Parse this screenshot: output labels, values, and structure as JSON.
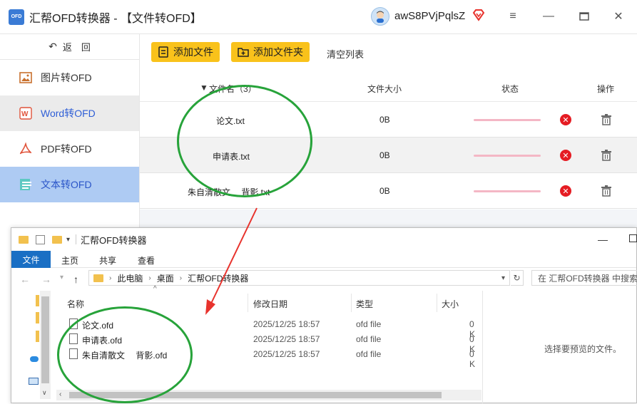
{
  "titlebar": {
    "logo_text": "OFD",
    "title": "汇帮OFD转换器 - 【文件转OFD】",
    "username": "awS8PVjPqlsZ"
  },
  "sidebar": {
    "back_label": "返　回",
    "items": [
      {
        "label": "图片转OFD",
        "icon": "image-icon"
      },
      {
        "label": "Word转OFD",
        "icon": "word-icon"
      },
      {
        "label": "PDF转OFD",
        "icon": "pdf-icon"
      },
      {
        "label": "文本转OFD",
        "icon": "text-doc-icon"
      }
    ]
  },
  "toolbar": {
    "add_file": "添加文件",
    "add_folder": "添加文件夹",
    "clear_list": "清空列表"
  },
  "table": {
    "headers": {
      "name": "文件名（3）",
      "size": "文件大小",
      "status": "状态",
      "action": "操作"
    },
    "rows": [
      {
        "name": "论文.txt",
        "size": "0B"
      },
      {
        "name": "申请表.txt",
        "size": "0B"
      },
      {
        "name": "朱自清散文　 背影.txt",
        "size": "0B"
      }
    ]
  },
  "explorer": {
    "title": "汇帮OFD转换器",
    "tabs": [
      "文件",
      "主页",
      "共享",
      "查看"
    ],
    "breadcrumb": [
      "此电脑",
      "桌面",
      "汇帮OFD转换器"
    ],
    "search_placeholder": "在 汇帮OFD转换器 中搜索",
    "columns": {
      "name": "名称",
      "date": "修改日期",
      "type": "类型",
      "size": "大小"
    },
    "files": [
      {
        "name": "论文.ofd",
        "date": "2025/12/25 18:57",
        "type": "ofd file",
        "size": "0 K"
      },
      {
        "name": "申请表.ofd",
        "date": "2025/12/25 18:57",
        "type": "ofd file",
        "size": "0 K"
      },
      {
        "name": "朱自清散文　 背影.ofd",
        "date": "2025/12/25 18:57",
        "type": "ofd file",
        "size": "0 K"
      }
    ],
    "preview_text": "选择要预览的文件。"
  },
  "colors": {
    "accent_yellow": "#f9c21b",
    "sidebar_active": "#aecbf3",
    "annotation_green": "#27a33a",
    "annotation_arrow": "#e8332d",
    "delete_red": "#e51c23"
  }
}
